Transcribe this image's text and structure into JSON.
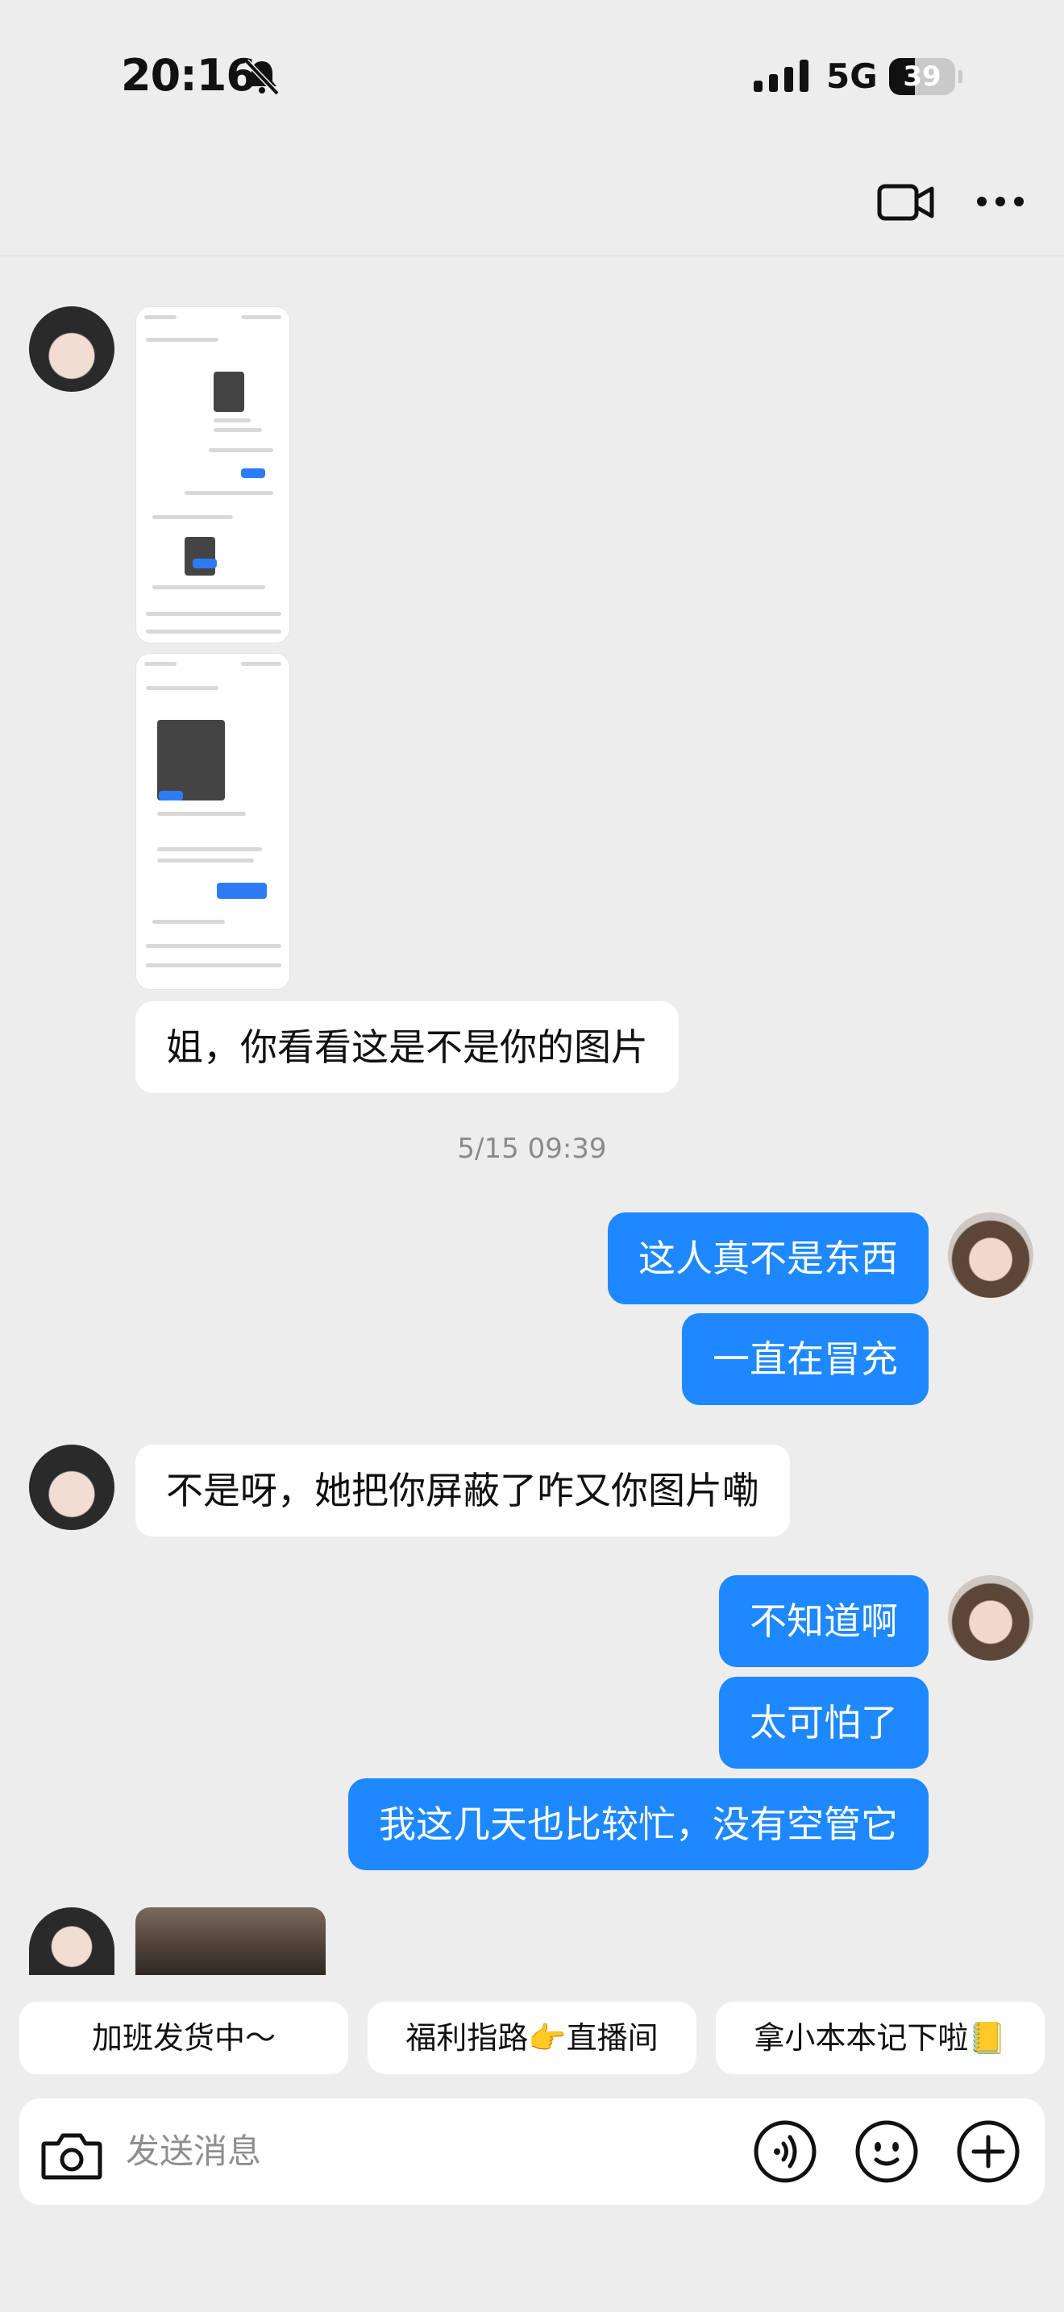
{
  "status_bar": {
    "time": "20:16",
    "network": "5G",
    "battery": "39",
    "battery_level": 0.39
  },
  "nav": {
    "video_icon": "video-camera-icon",
    "more_icon": "more-dots-icon"
  },
  "messages": [
    {
      "side": "in",
      "type": "image"
    },
    {
      "side": "in",
      "type": "image"
    },
    {
      "side": "in",
      "type": "text",
      "text": "姐，你看看这是不是你的图片"
    },
    {
      "side": "time",
      "text": "5/15 09:39"
    },
    {
      "side": "out",
      "type": "text",
      "text": "这人真不是东西"
    },
    {
      "side": "out",
      "type": "text",
      "text": "一直在冒充"
    },
    {
      "side": "in",
      "type": "text",
      "text": "不是呀，她把你屏蔽了咋又你图片嘞"
    },
    {
      "side": "out",
      "type": "text",
      "text": "不知道啊"
    },
    {
      "side": "out",
      "type": "text",
      "text": "太可怕了"
    },
    {
      "side": "out",
      "type": "text",
      "text": "我这几天也比较忙，没有空管它"
    },
    {
      "side": "in",
      "type": "image"
    }
  ],
  "quick_replies": [
    "加班发货中～",
    "福利指路👉直播间",
    "拿小本本记下啦📒"
  ],
  "input": {
    "placeholder": "发送消息",
    "icons": [
      "camera-icon",
      "voice-icon",
      "emoji-icon",
      "plus-icon"
    ]
  }
}
